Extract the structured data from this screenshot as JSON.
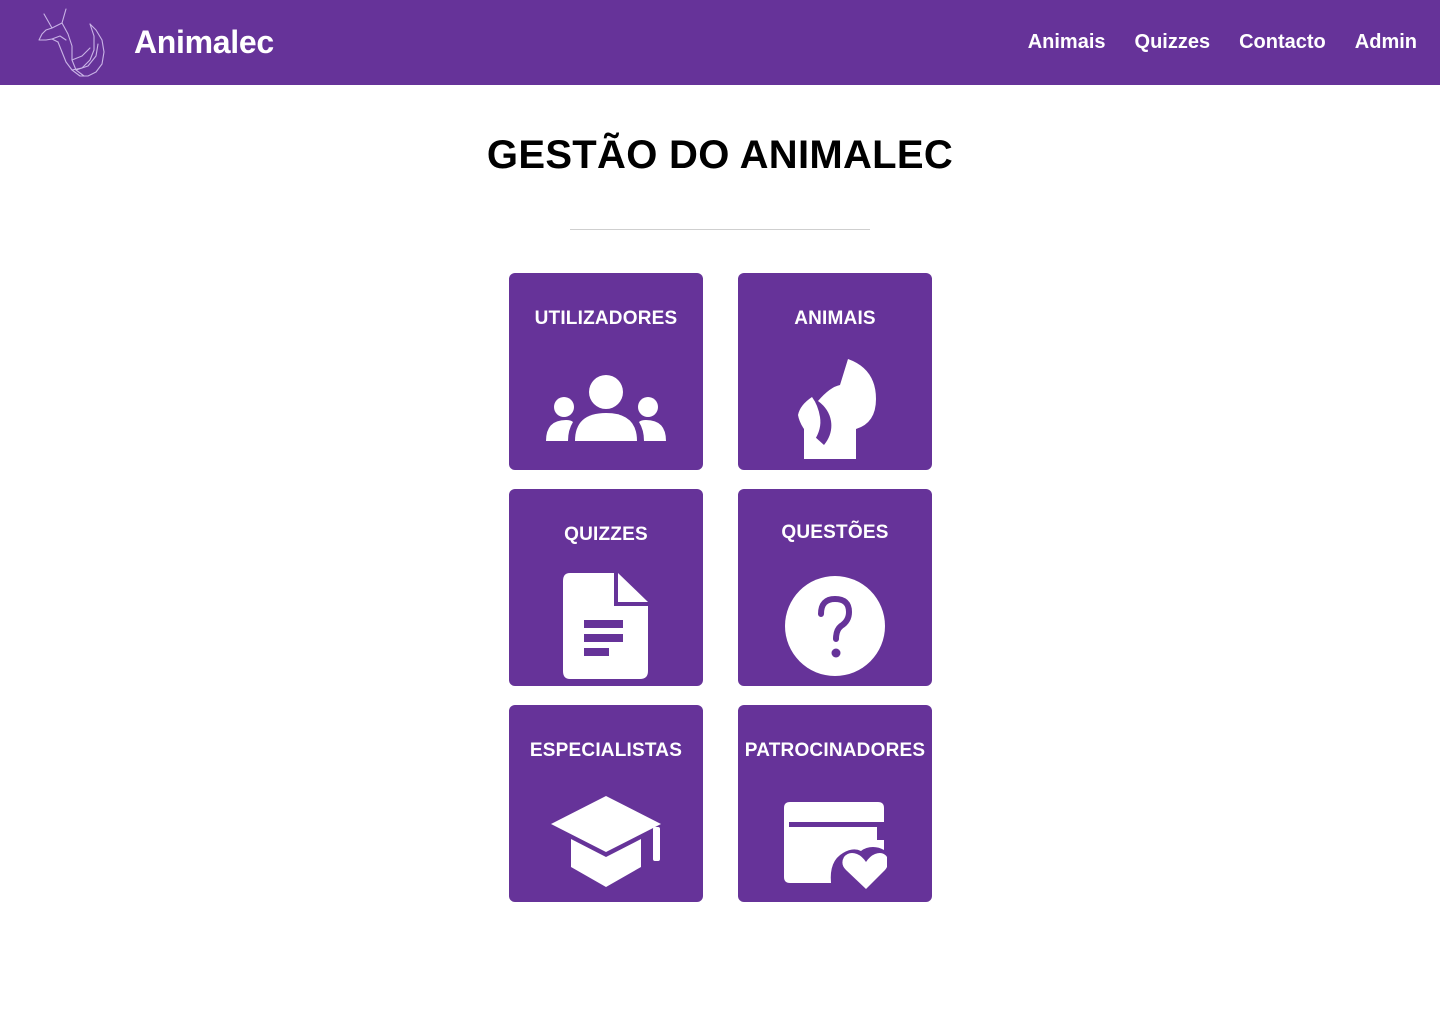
{
  "header": {
    "brand": "Animalec",
    "logo_icon": "fox-logo-icon",
    "nav": [
      {
        "label": "Animais"
      },
      {
        "label": "Quizzes"
      },
      {
        "label": "Contacto"
      },
      {
        "label": "Admin"
      }
    ]
  },
  "main": {
    "title": "GESTÃO DO ANIMALEC",
    "tiles": [
      {
        "label": "UTILIZADORES",
        "icon": "users-icon"
      },
      {
        "label": "ANIMAIS",
        "icon": "animal-icon"
      },
      {
        "label": "QUIZZES",
        "icon": "document-icon"
      },
      {
        "label": "QUESTÕES",
        "icon": "question-icon"
      },
      {
        "label": "ESPECIALISTAS",
        "icon": "graduation-cap-icon"
      },
      {
        "label": "PATROCINADORES",
        "icon": "sponsor-card-heart-icon"
      }
    ]
  },
  "colors": {
    "primary": "#663399",
    "text_on_primary": "#ffffff",
    "background": "#ffffff",
    "title": "#000000"
  }
}
